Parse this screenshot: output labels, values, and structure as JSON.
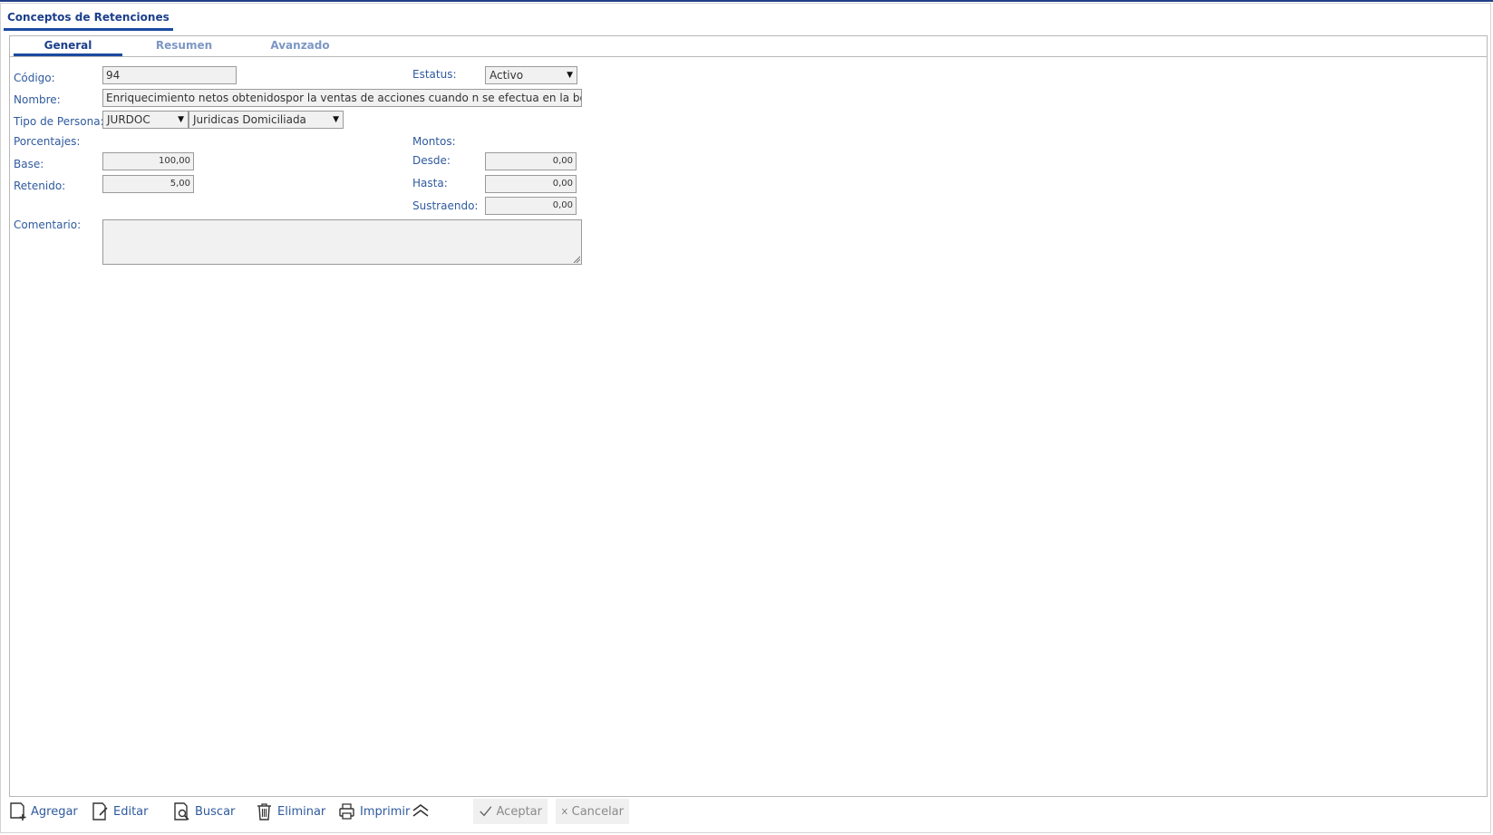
{
  "window": {
    "title": "Conceptos de Retenciones"
  },
  "tabs": [
    {
      "label": "General"
    },
    {
      "label": "Resumen"
    },
    {
      "label": "Avanzado"
    }
  ],
  "form": {
    "codigo": {
      "label": "Código:",
      "value": "94"
    },
    "estatus": {
      "label": "Estatus:",
      "value": "Activo"
    },
    "nombre": {
      "label": "Nombre:",
      "value": "Enriquecimiento netos obtenidospor la ventas de acciones cuando n se efectua en la bolsa"
    },
    "tipo_persona": {
      "label": "Tipo de Persona:",
      "code": "JURDOC",
      "description": "Juridicas Domiciliada"
    },
    "porcentajes": {
      "label": "Porcentajes:"
    },
    "montos": {
      "label": "Montos:"
    },
    "base": {
      "label": "Base:",
      "value": "100,00"
    },
    "retenido": {
      "label": "Retenido:",
      "value": "5,00"
    },
    "desde": {
      "label": "Desde:",
      "value": "0,00"
    },
    "hasta": {
      "label": "Hasta:",
      "value": "0,00"
    },
    "sustraendo": {
      "label": "Sustraendo:",
      "value": "0,00"
    },
    "comentario": {
      "label": "Comentario:",
      "value": ""
    }
  },
  "toolbar": {
    "agregar": "Agregar",
    "editar": "Editar",
    "buscar": "Buscar",
    "eliminar": "Eliminar",
    "imprimir": "Imprimir",
    "aceptar": "Aceptar",
    "cancelar": "Cancelar"
  },
  "colors": {
    "accent": "#1b4aa0",
    "label": "#2f5a9e",
    "field_bg": "#f1f1f1"
  },
  "icons": [
    "add-document-icon",
    "edit-document-icon",
    "search-document-icon",
    "trash-icon",
    "printer-icon",
    "collapse-up-icon",
    "check-icon",
    "close-icon",
    "dropdown-caret-icon",
    "resize-grip-icon"
  ]
}
